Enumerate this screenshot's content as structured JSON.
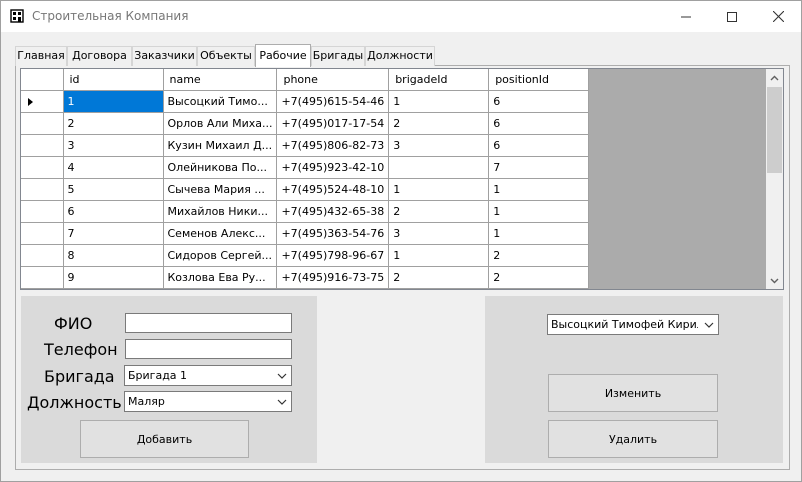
{
  "window": {
    "title": "Строительная Компания"
  },
  "tabs": [
    "Главная",
    "Договора",
    "Заказчики",
    "Объекты",
    "Рабочие",
    "Бригады",
    "Должности"
  ],
  "active_tab_index": 4,
  "grid": {
    "columns": [
      "id",
      "name",
      "phone",
      "brigadeId",
      "positionId"
    ],
    "rows": [
      {
        "id": "1",
        "name": "Высоцкий Тимо...",
        "phone": "+7(495)615-54-46",
        "brigadeId": "1",
        "positionId": "6"
      },
      {
        "id": "2",
        "name": "Орлов Али Миха...",
        "phone": "+7(495)017-17-54",
        "brigadeId": "2",
        "positionId": "6"
      },
      {
        "id": "3",
        "name": "Кузин Михаил Д...",
        "phone": "+7(495)806-82-73",
        "brigadeId": "3",
        "positionId": "6"
      },
      {
        "id": "4",
        "name": "Олейникова По...",
        "phone": "+7(495)923-42-10",
        "brigadeId": "",
        "positionId": "7"
      },
      {
        "id": "5",
        "name": "Сычева Мария ...",
        "phone": "+7(495)524-48-10",
        "brigadeId": "1",
        "positionId": "1"
      },
      {
        "id": "6",
        "name": "Михайлов Ники...",
        "phone": "+7(495)432-65-38",
        "brigadeId": "2",
        "positionId": "1"
      },
      {
        "id": "7",
        "name": "Семенов Алекс...",
        "phone": "+7(495)363-54-76",
        "brigadeId": "3",
        "positionId": "1"
      },
      {
        "id": "8",
        "name": "Сидоров Сергей...",
        "phone": "+7(495)798-96-67",
        "brigadeId": "1",
        "positionId": "2"
      },
      {
        "id": "9",
        "name": "Козлова Ева Ру...",
        "phone": "+7(495)916-73-75",
        "brigadeId": "2",
        "positionId": "2"
      }
    ],
    "selected_row": 0,
    "selected_column": "id"
  },
  "add_form": {
    "fio_label": "ФИО",
    "fio_value": "",
    "phone_label": "Телефон",
    "phone_value": "",
    "brigade_label": "Бригада",
    "brigade_value": "Бригада 1",
    "position_label": "Должность",
    "position_value": "Маляр",
    "add_button": "Добавить"
  },
  "edit_form": {
    "worker_value": "Высоцкий Тимофей Кириллович",
    "edit_button": "Изменить",
    "delete_button": "Удалить"
  },
  "icons": {
    "app": "building-app-icon",
    "minimize": "minimize-icon",
    "maximize": "maximize-icon",
    "close": "close-icon",
    "row_pointer": "row-pointer-icon",
    "scroll_up": "scroll-up-arrow-icon",
    "scroll_down": "scroll-down-arrow-icon",
    "dropdown": "chevron-down-icon"
  },
  "colors": {
    "selection": "#0078d7",
    "panel": "#dadada",
    "window_bg": "#f0f0f0",
    "grid_bg": "#ababab"
  }
}
